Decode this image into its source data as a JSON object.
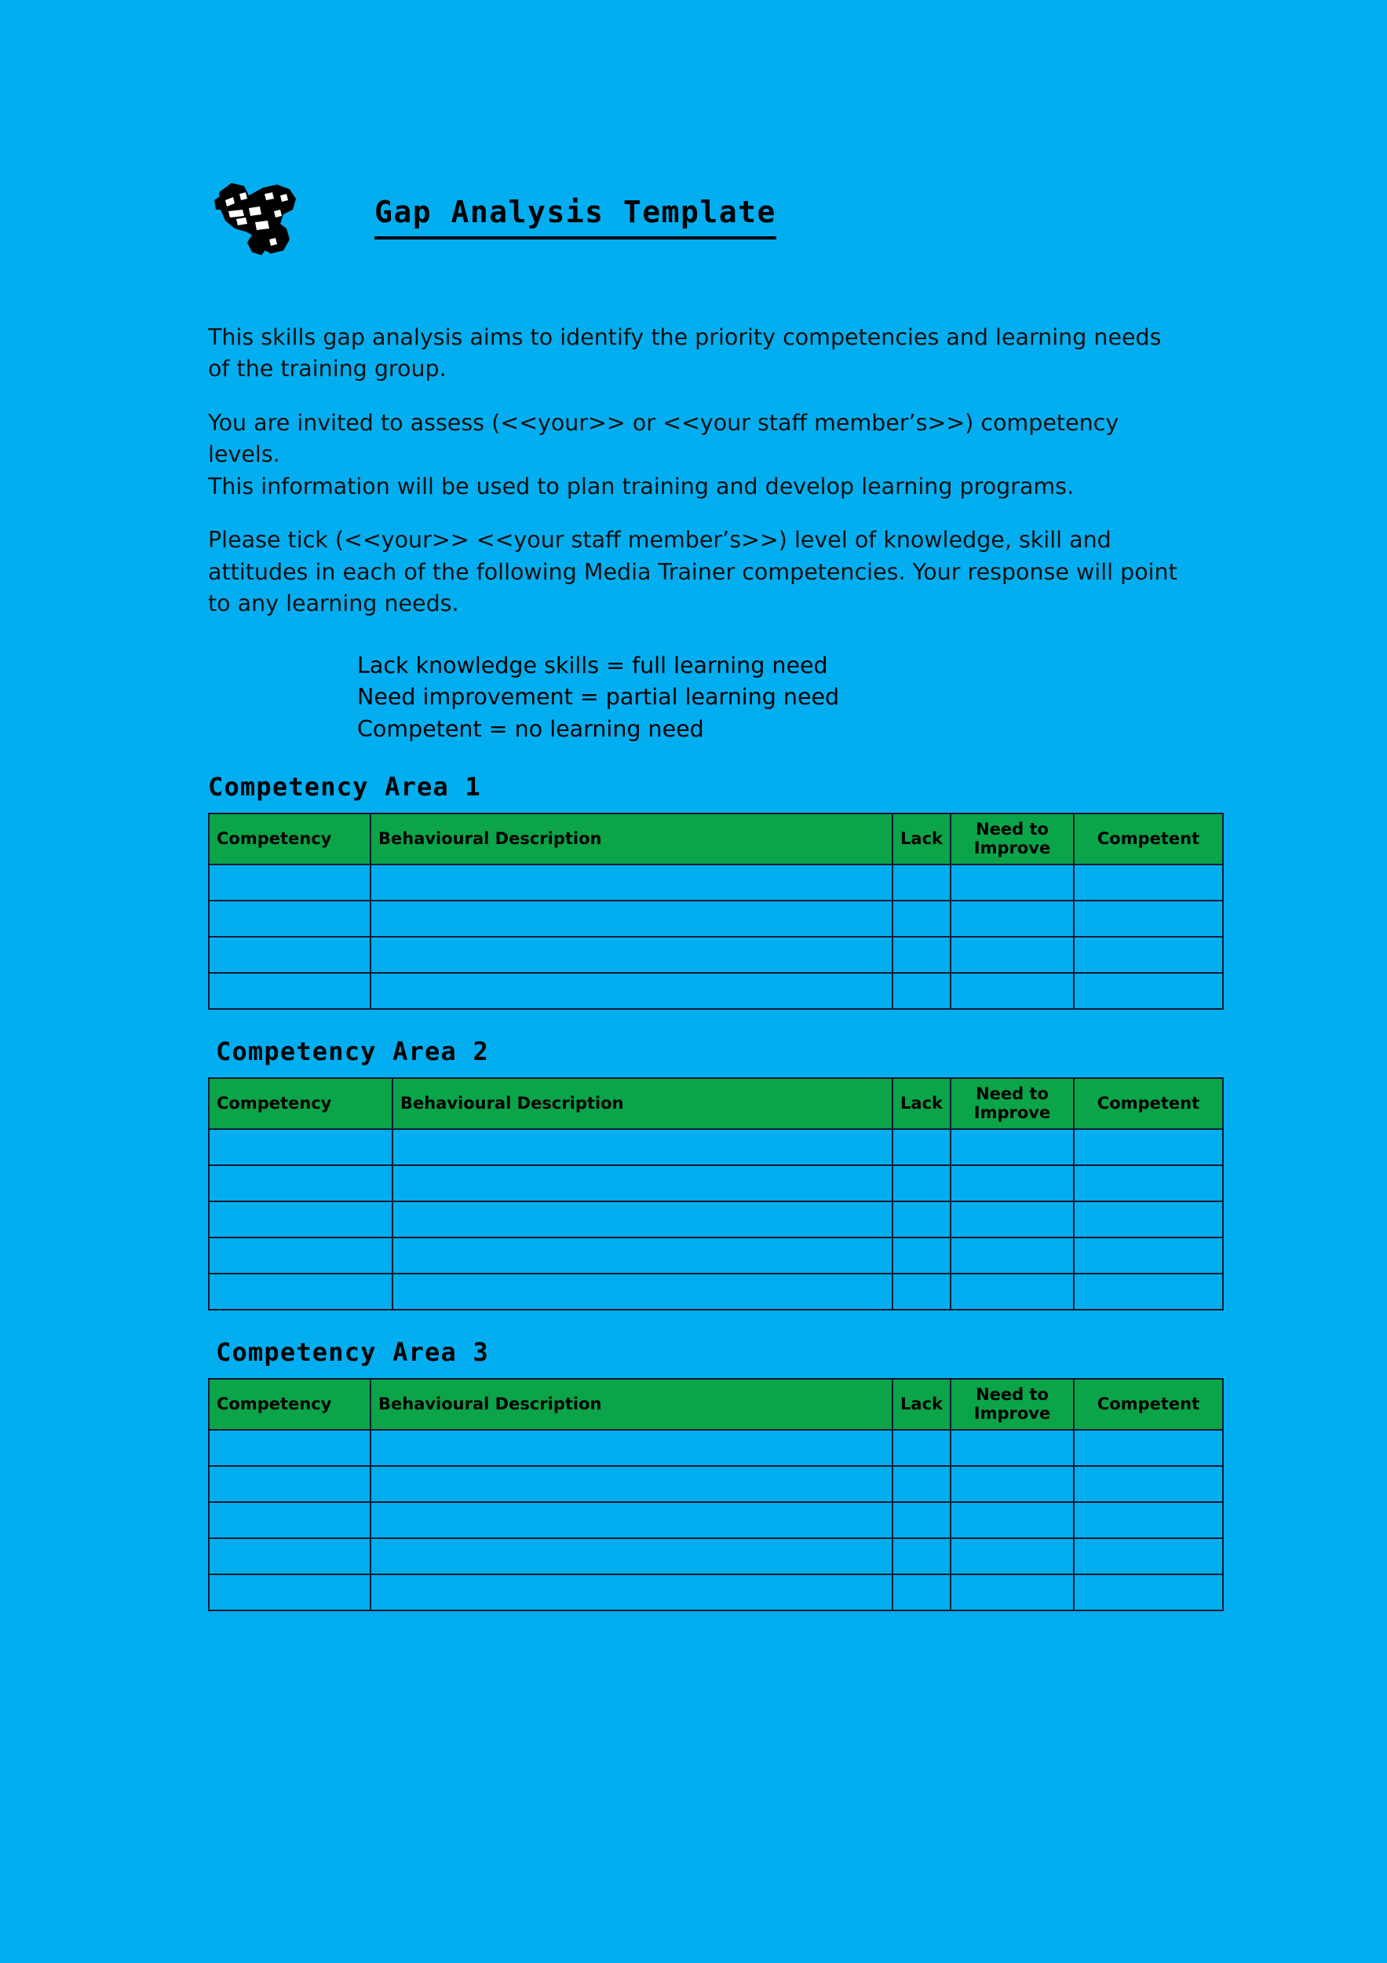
{
  "document": {
    "title": "Gap Analysis Template",
    "logo_icon": "camera-clipart-icon"
  },
  "intro": {
    "paragraph_1": "This skills gap analysis aims to identify the priority competencies and learning needs of the training group.",
    "paragraph_2_line_1": "You are invited to assess (<<your>> or <<your staff member’s>>) competency levels.",
    "paragraph_2_line_2": "This information will be used to plan training and develop learning programs.",
    "paragraph_3": "Please tick (<<your>> <<your staff member’s>>) level of knowledge, skill and attitudes in each of the following Media Trainer competencies. Your response will point to any learning needs."
  },
  "legend": {
    "line_1": "Lack knowledge skills = full learning need",
    "line_2": "Need improvement = partial learning need",
    "line_3": "Competent = no learning need"
  },
  "table_headers": {
    "competency": "Competency",
    "behavioural_description": "Behavioural Description",
    "lack": "Lack",
    "need_to_improve": "Need to Improve",
    "competent": "Competent"
  },
  "sections": [
    {
      "heading": "Competency Area 1",
      "row_count": 4,
      "rows": [
        {
          "competency": "",
          "behavioural_description": "",
          "lack": "",
          "need_to_improve": "",
          "competent": ""
        },
        {
          "competency": "",
          "behavioural_description": "",
          "lack": "",
          "need_to_improve": "",
          "competent": ""
        },
        {
          "competency": "",
          "behavioural_description": "",
          "lack": "",
          "need_to_improve": "",
          "competent": ""
        },
        {
          "competency": "",
          "behavioural_description": "",
          "lack": "",
          "need_to_improve": "",
          "competent": ""
        }
      ]
    },
    {
      "heading": "Competency Area 2",
      "row_count": 5,
      "rows": [
        {
          "competency": "",
          "behavioural_description": "",
          "lack": "",
          "need_to_improve": "",
          "competent": ""
        },
        {
          "competency": "",
          "behavioural_description": "",
          "lack": "",
          "need_to_improve": "",
          "competent": ""
        },
        {
          "competency": "",
          "behavioural_description": "",
          "lack": "",
          "need_to_improve": "",
          "competent": ""
        },
        {
          "competency": "",
          "behavioural_description": "",
          "lack": "",
          "need_to_improve": "",
          "competent": ""
        },
        {
          "competency": "",
          "behavioural_description": "",
          "lack": "",
          "need_to_improve": "",
          "competent": ""
        }
      ]
    },
    {
      "heading": "Competency Area 3",
      "row_count": 5,
      "rows": [
        {
          "competency": "",
          "behavioural_description": "",
          "lack": "",
          "need_to_improve": "",
          "competent": ""
        },
        {
          "competency": "",
          "behavioural_description": "",
          "lack": "",
          "need_to_improve": "",
          "competent": ""
        },
        {
          "competency": "",
          "behavioural_description": "",
          "lack": "",
          "need_to_improve": "",
          "competent": ""
        },
        {
          "competency": "",
          "behavioural_description": "",
          "lack": "",
          "need_to_improve": "",
          "competent": ""
        },
        {
          "competency": "",
          "behavioural_description": "",
          "lack": "",
          "need_to_improve": "",
          "competent": ""
        }
      ]
    }
  ],
  "colors": {
    "page_background": "#03aef0",
    "table_header_green": "#0ba448",
    "border": "#0c1a33",
    "text": "#000000"
  }
}
